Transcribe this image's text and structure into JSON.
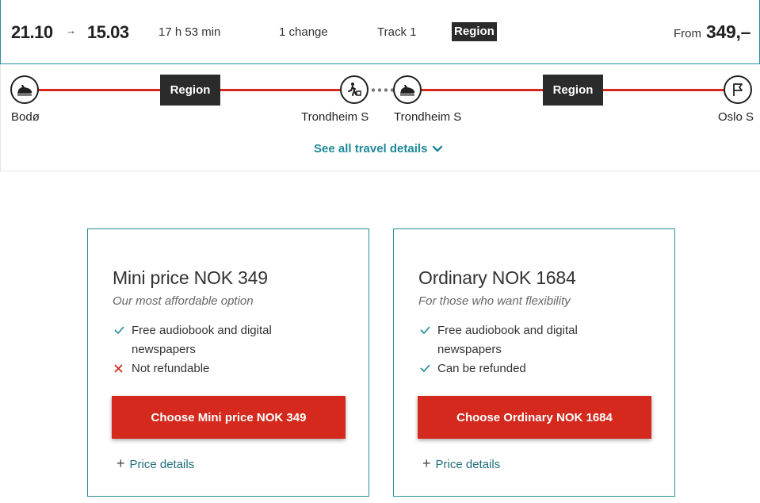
{
  "header": {
    "departure": "21.10",
    "arrow": "→",
    "arrival": "15.03",
    "duration": "17 h 53 min",
    "changes": "1 change",
    "track": "Track 1",
    "badge": "Region",
    "from_label": "From",
    "price": "349,–"
  },
  "route": {
    "stations": [
      "Bodø",
      "Trondheim S",
      "Trondheim S",
      "Oslo S"
    ],
    "segments": [
      "Region",
      "Region"
    ],
    "see_all_label": "See all travel details",
    "colors": {
      "line": "#d4291c",
      "link": "#1f8898"
    }
  },
  "cards": [
    {
      "title": "Mini price NOK 349",
      "subtitle": "Our most affordable option",
      "features": [
        {
          "icon": "check-icon",
          "text": "Free audiobook and digital newspapers"
        },
        {
          "icon": "cross-icon",
          "text": "Not refundable"
        }
      ],
      "button": "Choose Mini price NOK 349",
      "details": "Price details"
    },
    {
      "title": "Ordinary NOK 1684",
      "subtitle": "For those who want flexibility",
      "features": [
        {
          "icon": "check-icon",
          "text": "Free audiobook and digital newspapers"
        },
        {
          "icon": "check-icon",
          "text": "Can be refunded"
        }
      ],
      "button": "Choose Ordinary NOK 1684",
      "details": "Price details"
    }
  ],
  "colors": {
    "accent": "#d4291c",
    "border": "#2a8e9a",
    "badge": "#2b2b2b"
  }
}
